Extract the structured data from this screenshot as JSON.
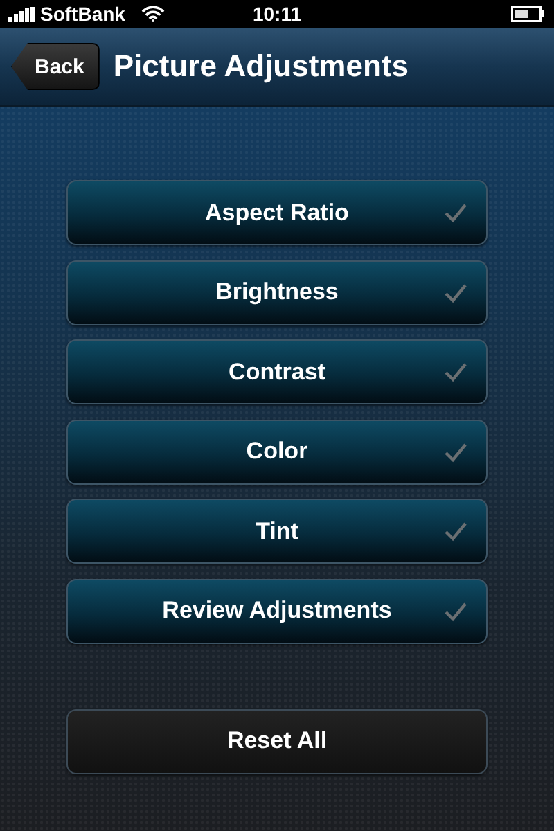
{
  "status_bar": {
    "carrier": "SoftBank",
    "time": "10:11"
  },
  "nav_bar": {
    "back_button": "Back",
    "title": "Picture Adjustments"
  },
  "menu": [
    {
      "label": "Aspect Ratio"
    },
    {
      "label": "Brightness"
    },
    {
      "label": "Contrast"
    },
    {
      "label": "Color"
    },
    {
      "label": "Tint"
    },
    {
      "label": "Review Adjustments"
    }
  ],
  "reset_button": "Reset All"
}
